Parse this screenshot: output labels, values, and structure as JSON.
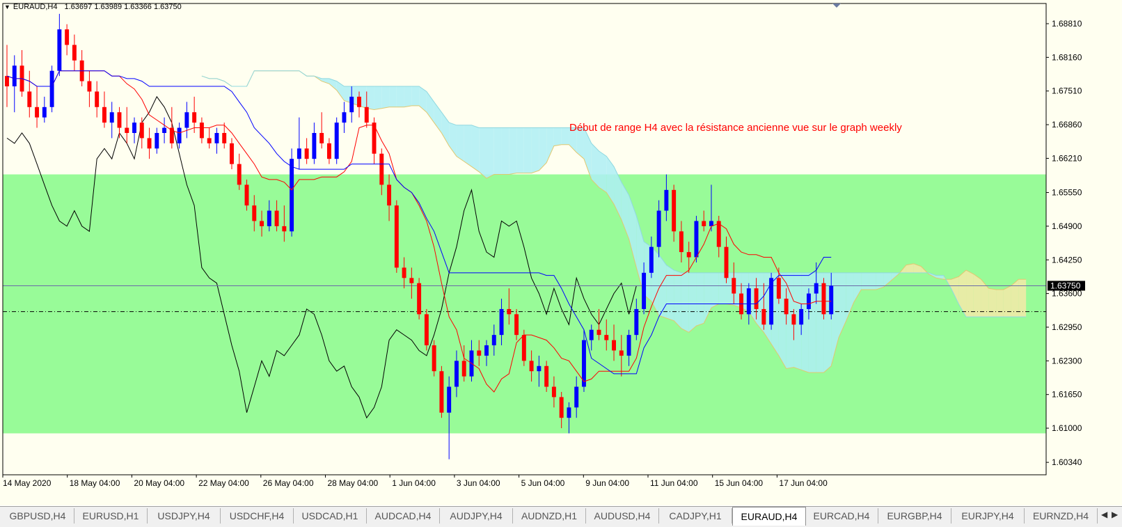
{
  "header": {
    "symbol": "EURAUD,H4",
    "quotes": "1.63697 1.63989 1.63366 1.63750"
  },
  "annotation": {
    "text_main": "Début de range H4 avec la résistance ancienne vue sur ",
    "text_tail": "le graph weekly"
  },
  "colors": {
    "background": "#fffff0",
    "range_zone": "#98fb98",
    "bull_candle": "#0000ff",
    "bear_candle": "#ff0000",
    "tenkan": "#ff0000",
    "kijun": "#0000ff",
    "chikou": "#000000",
    "kumo_up": "#f5e9a8",
    "kumo_down": "#aeeef4",
    "annotation": "#ff0000"
  },
  "chart_data": {
    "type": "candlestick",
    "symbol": "EURAUD",
    "timeframe": "H4",
    "indicator": "Ichimoku Kinko Hyo",
    "current_price": "1.63750",
    "price_ticks": [
      "1.68810",
      "1.68160",
      "1.67510",
      "1.66860",
      "1.66210",
      "1.65550",
      "1.64900",
      "1.64250",
      "1.63600",
      "1.62950",
      "1.62300",
      "1.61650",
      "1.61000",
      "1.60340"
    ],
    "time_ticks": [
      "14 May 2020",
      "18 May 04:00",
      "20 May 04:00",
      "22 May 04:00",
      "26 May 04:00",
      "28 May 04:00",
      "1 Jun 04:00",
      "3 Jun 04:00",
      "5 Jun 04:00",
      "9 Jun 04:00",
      "11 Jun 04:00",
      "15 Jun 04:00",
      "17 Jun 04:00"
    ],
    "ylim": [
      1.601,
      1.692
    ],
    "range_zone": {
      "top": 1.659,
      "bottom": 1.609
    },
    "horizontal_lines": [
      {
        "value": 1.6375,
        "style": "solid"
      },
      {
        "value": 1.6325,
        "style": "dash-dot"
      }
    ],
    "candles": [
      [
        1.678,
        1.684,
        1.672,
        1.676
      ],
      [
        1.676,
        1.682,
        1.671,
        1.68
      ],
      [
        1.68,
        1.683,
        1.674,
        1.675
      ],
      [
        1.675,
        1.679,
        1.67,
        1.672
      ],
      [
        1.672,
        1.676,
        1.668,
        1.67
      ],
      [
        1.67,
        1.674,
        1.669,
        1.672
      ],
      [
        1.672,
        1.68,
        1.671,
        1.679
      ],
      [
        1.679,
        1.69,
        1.678,
        1.687
      ],
      [
        1.687,
        1.688,
        1.682,
        1.684
      ],
      [
        1.684,
        1.686,
        1.679,
        1.681
      ],
      [
        1.681,
        1.683,
        1.676,
        1.677
      ],
      [
        1.677,
        1.679,
        1.672,
        1.675
      ],
      [
        1.675,
        1.677,
        1.67,
        1.672
      ],
      [
        1.672,
        1.675,
        1.668,
        1.669
      ],
      [
        1.669,
        1.673,
        1.666,
        1.671
      ],
      [
        1.671,
        1.672,
        1.666,
        1.668
      ],
      [
        1.668,
        1.672,
        1.665,
        1.667
      ],
      [
        1.667,
        1.67,
        1.665,
        1.669
      ],
      [
        1.669,
        1.67,
        1.664,
        1.666
      ],
      [
        1.666,
        1.668,
        1.662,
        1.664
      ],
      [
        1.664,
        1.668,
        1.663,
        1.667
      ],
      [
        1.667,
        1.67,
        1.665,
        1.668
      ],
      [
        1.668,
        1.672,
        1.664,
        1.665
      ],
      [
        1.665,
        1.669,
        1.664,
        1.668
      ],
      [
        1.668,
        1.673,
        1.666,
        1.671
      ],
      [
        1.671,
        1.674,
        1.667,
        1.669
      ],
      [
        1.669,
        1.67,
        1.665,
        1.666
      ],
      [
        1.666,
        1.668,
        1.664,
        1.665
      ],
      [
        1.665,
        1.668,
        1.663,
        1.667
      ],
      [
        1.667,
        1.669,
        1.664,
        1.665
      ],
      [
        1.665,
        1.666,
        1.66,
        1.661
      ],
      [
        1.661,
        1.663,
        1.656,
        1.657
      ],
      [
        1.657,
        1.658,
        1.652,
        1.653
      ],
      [
        1.653,
        1.655,
        1.648,
        1.65
      ],
      [
        1.65,
        1.652,
        1.647,
        1.649
      ],
      [
        1.649,
        1.654,
        1.648,
        1.652
      ],
      [
        1.652,
        1.654,
        1.648,
        1.649
      ],
      [
        1.649,
        1.653,
        1.646,
        1.648
      ],
      [
        1.648,
        1.664,
        1.647,
        1.662
      ],
      [
        1.662,
        1.67,
        1.66,
        1.664
      ],
      [
        1.664,
        1.666,
        1.661,
        1.662
      ],
      [
        1.662,
        1.669,
        1.661,
        1.667
      ],
      [
        1.667,
        1.671,
        1.664,
        1.665
      ],
      [
        1.665,
        1.666,
        1.661,
        1.662
      ],
      [
        1.662,
        1.67,
        1.661,
        1.669
      ],
      [
        1.669,
        1.673,
        1.667,
        1.671
      ],
      [
        1.671,
        1.676,
        1.669,
        1.674
      ],
      [
        1.674,
        1.675,
        1.67,
        1.672
      ],
      [
        1.672,
        1.675,
        1.668,
        1.669
      ],
      [
        1.669,
        1.67,
        1.661,
        1.663
      ],
      [
        1.663,
        1.664,
        1.655,
        1.657
      ],
      [
        1.657,
        1.659,
        1.65,
        1.653
      ],
      [
        1.653,
        1.654,
        1.64,
        1.641
      ],
      [
        1.641,
        1.643,
        1.637,
        1.639
      ],
      [
        1.639,
        1.641,
        1.635,
        1.638
      ],
      [
        1.638,
        1.639,
        1.631,
        1.632
      ],
      [
        1.632,
        1.633,
        1.625,
        1.626
      ],
      [
        1.626,
        1.627,
        1.62,
        1.621
      ],
      [
        1.621,
        1.622,
        1.612,
        1.613
      ],
      [
        1.613,
        1.62,
        1.604,
        1.618
      ],
      [
        1.618,
        1.625,
        1.616,
        1.623
      ],
      [
        1.623,
        1.626,
        1.619,
        1.62
      ],
      [
        1.62,
        1.627,
        1.619,
        1.625
      ],
      [
        1.625,
        1.627,
        1.622,
        1.624
      ],
      [
        1.624,
        1.627,
        1.622,
        1.626
      ],
      [
        1.626,
        1.63,
        1.624,
        1.628
      ],
      [
        1.628,
        1.635,
        1.626,
        1.633
      ],
      [
        1.633,
        1.637,
        1.63,
        1.632
      ],
      [
        1.632,
        1.633,
        1.627,
        1.628
      ],
      [
        1.628,
        1.629,
        1.622,
        1.623
      ],
      [
        1.623,
        1.625,
        1.619,
        1.621
      ],
      [
        1.621,
        1.624,
        1.618,
        1.622
      ],
      [
        1.622,
        1.623,
        1.617,
        1.618
      ],
      [
        1.618,
        1.62,
        1.614,
        1.616
      ],
      [
        1.616,
        1.617,
        1.61,
        1.612
      ],
      [
        1.612,
        1.615,
        1.609,
        1.614
      ],
      [
        1.614,
        1.62,
        1.612,
        1.618
      ],
      [
        1.618,
        1.629,
        1.617,
        1.627
      ],
      [
        1.627,
        1.63,
        1.625,
        1.629
      ],
      [
        1.629,
        1.633,
        1.627,
        1.628
      ],
      [
        1.628,
        1.631,
        1.625,
        1.627
      ],
      [
        1.627,
        1.63,
        1.623,
        1.625
      ],
      [
        1.625,
        1.628,
        1.62,
        1.624
      ],
      [
        1.624,
        1.629,
        1.622,
        1.628
      ],
      [
        1.628,
        1.635,
        1.627,
        1.633
      ],
      [
        1.633,
        1.642,
        1.632,
        1.64
      ],
      [
        1.64,
        1.647,
        1.639,
        1.645
      ],
      [
        1.645,
        1.654,
        1.643,
        1.652
      ],
      [
        1.652,
        1.659,
        1.65,
        1.656
      ],
      [
        1.656,
        1.657,
        1.646,
        1.648
      ],
      [
        1.648,
        1.65,
        1.642,
        1.644
      ],
      [
        1.644,
        1.646,
        1.64,
        1.643
      ],
      [
        1.643,
        1.651,
        1.642,
        1.65
      ],
      [
        1.65,
        1.652,
        1.648,
        1.649
      ],
      [
        1.649,
        1.657,
        1.648,
        1.65
      ],
      [
        1.65,
        1.651,
        1.643,
        1.645
      ],
      [
        1.645,
        1.647,
        1.638,
        1.639
      ],
      [
        1.639,
        1.642,
        1.634,
        1.636
      ],
      [
        1.636,
        1.638,
        1.631,
        1.632
      ],
      [
        1.632,
        1.638,
        1.63,
        1.637
      ],
      [
        1.637,
        1.639,
        1.631,
        1.633
      ],
      [
        1.633,
        1.638,
        1.629,
        1.63
      ],
      [
        1.63,
        1.64,
        1.629,
        1.639
      ],
      [
        1.639,
        1.641,
        1.634,
        1.635
      ],
      [
        1.635,
        1.637,
        1.63,
        1.632
      ],
      [
        1.632,
        1.633,
        1.627,
        1.63
      ],
      [
        1.63,
        1.634,
        1.628,
        1.633
      ],
      [
        1.633,
        1.637,
        1.631,
        1.636
      ],
      [
        1.636,
        1.642,
        1.634,
        1.638
      ],
      [
        1.638,
        1.639,
        1.631,
        1.632
      ],
      [
        1.632,
        1.64,
        1.631,
        1.6375
      ]
    ]
  },
  "tabs": [
    "GBPUSD,H4",
    "EURUSD,H1",
    "USDJPY,H4",
    "USDCHF,H4",
    "USDCAD,H1",
    "AUDCAD,H4",
    "AUDJPY,H4",
    "AUDNZD,H1",
    "AUDUSD,H4",
    "CADJPY,H1",
    "EURAUD,H4",
    "EURCAD,H4",
    "EURGBP,H4",
    "EURJPY,H4",
    "EURNZD,H4"
  ],
  "active_tab": "EURAUD,H4",
  "tab_nav": {
    "left": "◀",
    "right": "▶"
  }
}
